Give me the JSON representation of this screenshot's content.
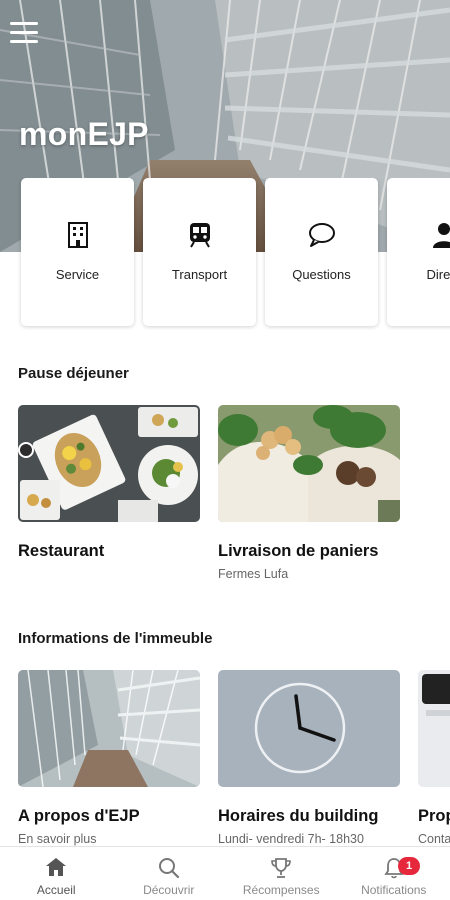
{
  "app": {
    "title": "monEJP"
  },
  "quick_links": [
    {
      "label": "Service",
      "icon": "building-icon"
    },
    {
      "label": "Transport",
      "icon": "train-icon"
    },
    {
      "label": "Questions",
      "icon": "chat-bubble-icon"
    },
    {
      "label": "Direct",
      "icon": "person-icon"
    }
  ],
  "sections": {
    "lunch": {
      "title": "Pause déjeuner",
      "items": [
        {
          "title": "Restaurant",
          "subtitle": ""
        },
        {
          "title": "Livraison de paniers",
          "subtitle": "Fermes Lufa"
        }
      ]
    },
    "building": {
      "title": "Informations de l'immeuble",
      "items": [
        {
          "title": "A propos d'EJP",
          "subtitle": "En savoir plus"
        },
        {
          "title": "Horaires du building",
          "subtitle": "Lundi- vendredi 7h- 18h30"
        },
        {
          "title": "Prop",
          "subtitle": "Conta"
        }
      ]
    }
  },
  "bottom_nav": [
    {
      "label": "Accueil",
      "icon": "home-icon"
    },
    {
      "label": "Découvrir",
      "icon": "search-icon"
    },
    {
      "label": "Récompenses",
      "icon": "trophy-icon"
    },
    {
      "label": "Notifications",
      "icon": "bell-icon"
    }
  ],
  "notifications_badge": "1",
  "colors": {
    "badge": "#e6283c",
    "text": "#1a1a1a",
    "muted": "#666666"
  }
}
